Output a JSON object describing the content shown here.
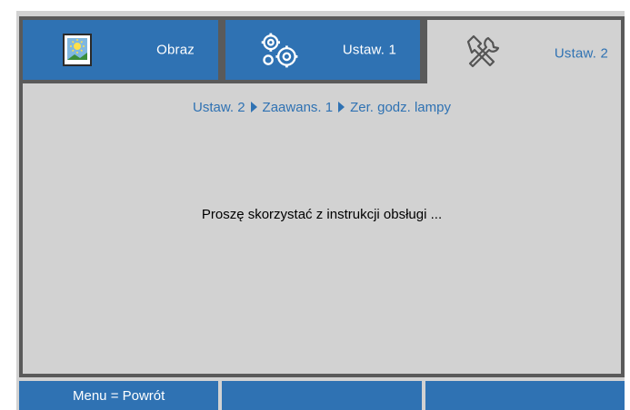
{
  "tabs": [
    {
      "label": "Obraz",
      "icon": "picture-icon",
      "active": false
    },
    {
      "label": "Ustaw. 1",
      "icon": "gears-icon",
      "active": false
    },
    {
      "label": "Ustaw. 2",
      "icon": "tools-icon",
      "active": true
    }
  ],
  "breadcrumb": {
    "items": [
      "Ustaw. 2",
      "Zaawans. 1",
      "Zer. godz. lampy"
    ]
  },
  "message": "Proszę skorzystać z instrukcji obsługi ...",
  "footer": {
    "cells": [
      "Menu = Powrót",
      "",
      ""
    ]
  },
  "colors": {
    "accent": "#2f72b3",
    "panel_bg": "#d2d2d2",
    "border": "#5a5a5a"
  }
}
